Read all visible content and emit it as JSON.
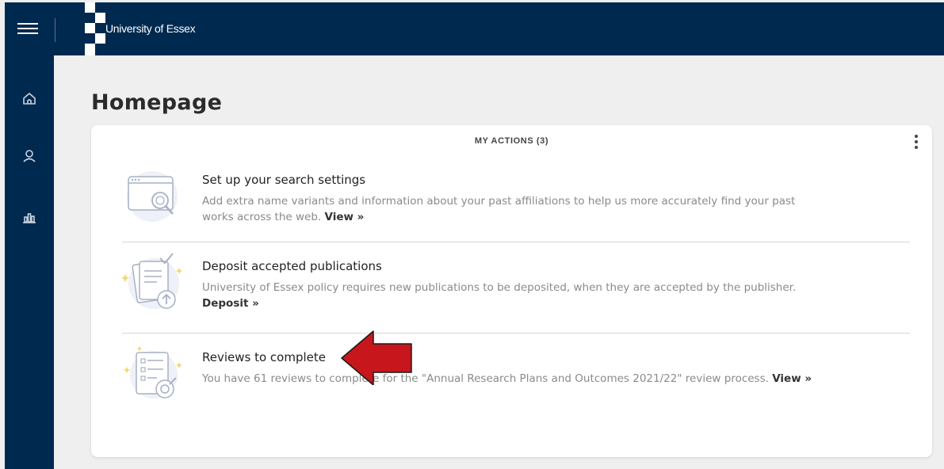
{
  "header": {
    "brand": "University of Essex",
    "bg_color": "#00294f"
  },
  "sidebar": {
    "items": [
      {
        "name": "home",
        "icon": "home-icon"
      },
      {
        "name": "profile",
        "icon": "user-icon"
      },
      {
        "name": "reporting",
        "icon": "bar-chart-icon"
      }
    ]
  },
  "page": {
    "title": "Homepage"
  },
  "actions_card": {
    "header": "MY ACTIONS (3)",
    "items": [
      {
        "title": "Set up your search settings",
        "description": "Add extra name variants and information about your past affiliations to help us more accurately find your past works across the web.",
        "link": "View »",
        "icon": "search-settings-illustration"
      },
      {
        "title": "Deposit accepted publications",
        "description": "University of Essex policy requires new publications to be deposited, when they are accepted by the publisher.",
        "link": "Deposit »",
        "icon": "deposit-illustration"
      },
      {
        "title": "Reviews to complete",
        "description": "You have 61 reviews to complete for the \"Annual Research Plans and Outcomes 2021/22\" review process.",
        "link": "View »",
        "icon": "reviews-illustration"
      }
    ]
  },
  "annotation": {
    "arrow_color": "#c8161d"
  }
}
